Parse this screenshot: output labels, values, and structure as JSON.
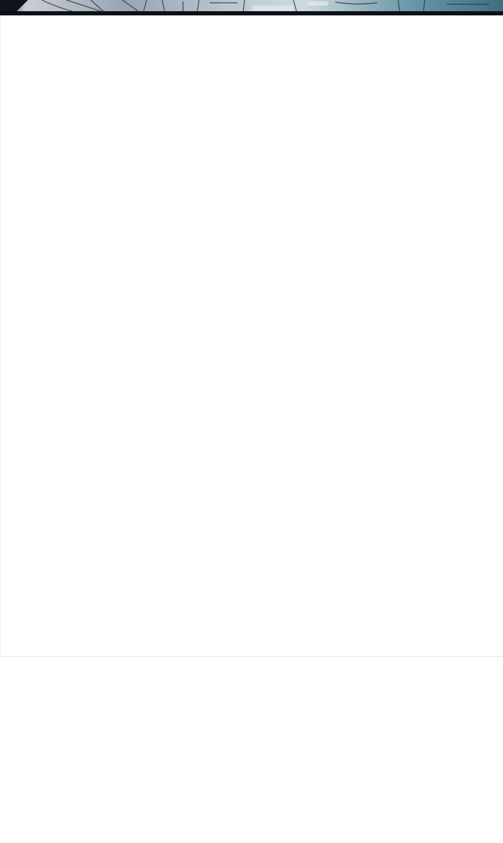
{
  "colors": {
    "background": "#ffffff",
    "panel_border": "#e6e6e6",
    "strip_dark": "#0d1016",
    "strip_teal": "#5f8fa0",
    "strip_light": "#c9d3da"
  },
  "comic_strip": {
    "description_icon": "comic-artwork-fragment"
  }
}
